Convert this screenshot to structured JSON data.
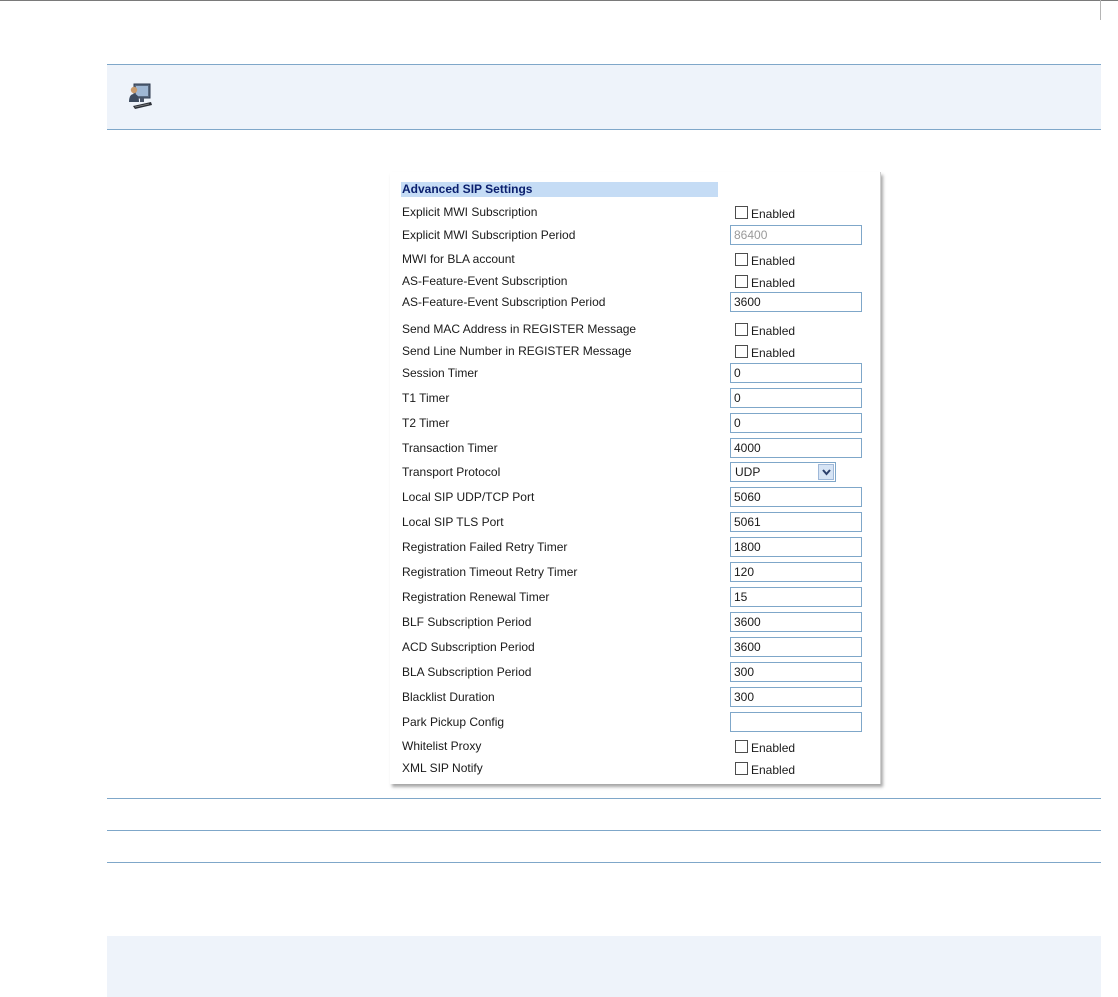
{
  "panel": {
    "title": "Advanced SIP Settings",
    "rows": [
      {
        "label": "Explicit MWI Subscription",
        "type": "checkbox",
        "text": "Enabled",
        "checked": false
      },
      {
        "label": "Explicit MWI Subscription Period",
        "type": "text",
        "value": "86400",
        "disabled": true
      },
      {
        "label": "MWI for BLA account",
        "type": "checkbox",
        "text": "Enabled",
        "checked": false
      },
      {
        "label": "AS-Feature-Event Subscription",
        "type": "checkbox",
        "text": "Enabled",
        "checked": false
      },
      {
        "label": "AS-Feature-Event Subscription Period",
        "type": "text",
        "value": "3600"
      },
      {
        "label": "Send MAC Address in REGISTER Message",
        "type": "checkbox",
        "text": "Enabled",
        "checked": false
      },
      {
        "label": "Send Line Number in REGISTER Message",
        "type": "checkbox",
        "text": "Enabled",
        "checked": false
      },
      {
        "label": "Session Timer",
        "type": "text",
        "value": "0"
      },
      {
        "label": "T1 Timer",
        "type": "text",
        "value": "0"
      },
      {
        "label": "T2 Timer",
        "type": "text",
        "value": "0"
      },
      {
        "label": "Transaction Timer",
        "type": "text",
        "value": "4000"
      },
      {
        "label": "Transport Protocol",
        "type": "select",
        "value": "UDP"
      },
      {
        "label": "Local SIP UDP/TCP Port",
        "type": "text",
        "value": "5060"
      },
      {
        "label": "Local SIP TLS Port",
        "type": "text",
        "value": "5061"
      },
      {
        "label": "Registration Failed Retry Timer",
        "type": "text",
        "value": "1800"
      },
      {
        "label": "Registration Timeout Retry Timer",
        "type": "text",
        "value": "120"
      },
      {
        "label": "Registration Renewal Timer",
        "type": "text",
        "value": "15"
      },
      {
        "label": "BLF Subscription Period",
        "type": "text",
        "value": "3600"
      },
      {
        "label": "ACD Subscription Period",
        "type": "text",
        "value": "3600"
      },
      {
        "label": "BLA Subscription Period",
        "type": "text",
        "value": "300"
      },
      {
        "label": "Blacklist Duration",
        "type": "text",
        "value": "300"
      },
      {
        "label": "Park Pickup Config",
        "type": "text",
        "value": ""
      },
      {
        "label": "Whitelist Proxy",
        "type": "checkbox",
        "text": "Enabled",
        "checked": false
      },
      {
        "label": "XML SIP Notify",
        "type": "checkbox",
        "text": "Enabled",
        "checked": false
      }
    ]
  },
  "icons": {
    "note": "computer-user-icon",
    "dropdown": "chevron-down-icon"
  },
  "colors": {
    "band_background": "#eef3fa",
    "rule": "#7fa7c9",
    "title_bar": "#c5dcf5",
    "title_text": "#0a1f6e"
  }
}
